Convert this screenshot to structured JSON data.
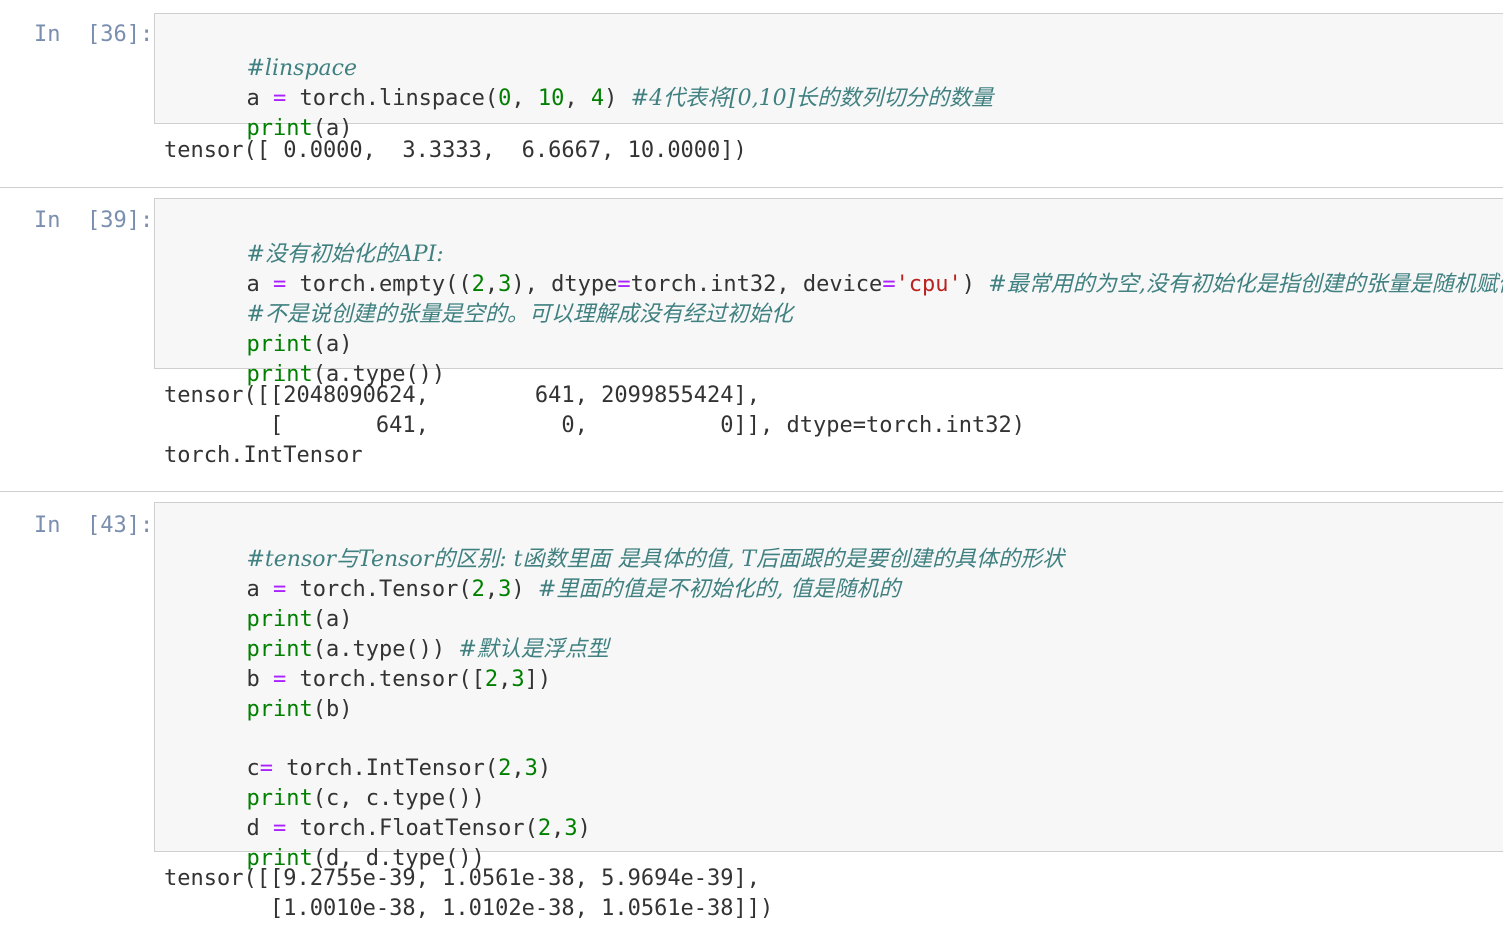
{
  "cells": [
    {
      "prompt": "In  [36]:",
      "code": {
        "l1_comment": "#linspace",
        "l2_a": "a ",
        "l2_eq": "=",
        "l2_call": " torch.linspace(",
        "l2_n1": "0",
        "l2_sep1": ", ",
        "l2_n2": "10",
        "l2_sep2": ", ",
        "l2_n3": "4",
        "l2_close": ") ",
        "l2_comment": "#4代表将[0,10]长的数列切分的数量",
        "l3_print": "print",
        "l3_args": "(a)"
      },
      "output": [
        "tensor([ 0.0000,  3.3333,  6.6667, 10.0000])"
      ]
    },
    {
      "prompt": "In  [39]:",
      "code": {
        "l1_comment": "#没有初始化的API:",
        "l2_a": "a ",
        "l2_eq": "=",
        "l2_call1": " torch.empty((",
        "l2_n1": "2",
        "l2_c1": ",",
        "l2_n2": "3",
        "l2_call2": "), dtype",
        "l2_eq2": "=",
        "l2_call3": "torch.int32, device",
        "l2_eq3": "=",
        "l2_str": "'cpu'",
        "l2_close": ") ",
        "l2_comment": "#最常用的为空,没有初始化是指创建的张量是随机赋值的,",
        "l3_comment": "#不是说创建的张量是空的。可以理解成没有经过初始化",
        "l4_print": "print",
        "l4_args": "(a)",
        "l5_print": "print",
        "l5_args": "(a.type())"
      },
      "output": [
        "tensor([[2048090624,        641, 2099855424],",
        "        [       641,          0,          0]], dtype=torch.int32)",
        "torch.IntTensor"
      ]
    },
    {
      "prompt": "In  [43]:",
      "code": {
        "l1_comment": "#tensor与Tensor的区别: t函数里面 是具体的值, T后面跟的是要创建的具体的形状",
        "l2_a": "a ",
        "l2_eq": "=",
        "l2_call": " torch.Tensor(",
        "l2_n1": "2",
        "l2_c": ",",
        "l2_n2": "3",
        "l2_close": ") ",
        "l2_comment": "#里面的值是不初始化的, 值是随机的",
        "l3_print": "print",
        "l3_args": "(a)",
        "l4_print": "print",
        "l4_args": "(a.type()) ",
        "l4_comment": "#默认是浮点型",
        "l5_b": "b ",
        "l5_eq": "=",
        "l5_call": " torch.tensor([",
        "l5_n1": "2",
        "l5_c": ",",
        "l5_n2": "3",
        "l5_close": "])",
        "l6_print": "print",
        "l6_args": "(b)",
        "l8_c": "c",
        "l8_eq": "=",
        "l8_call": " torch.IntTensor(",
        "l8_n1": "2",
        "l8_cm": ",",
        "l8_n2": "3",
        "l8_close": ")",
        "l9_print": "print",
        "l9_args": "(c, c.type())",
        "l10_d": "d ",
        "l10_eq": "=",
        "l10_call": " torch.FloatTensor(",
        "l10_n1": "2",
        "l10_cm": ",",
        "l10_n2": "3",
        "l10_close": ")",
        "l11_print": "print",
        "l11_args": "(d, d.type())"
      },
      "output": [
        "tensor([[9.2755e-39, 1.0561e-38, 5.9694e-39],",
        "        [1.0010e-38, 1.0102e-38, 1.0561e-38]])"
      ]
    }
  ]
}
